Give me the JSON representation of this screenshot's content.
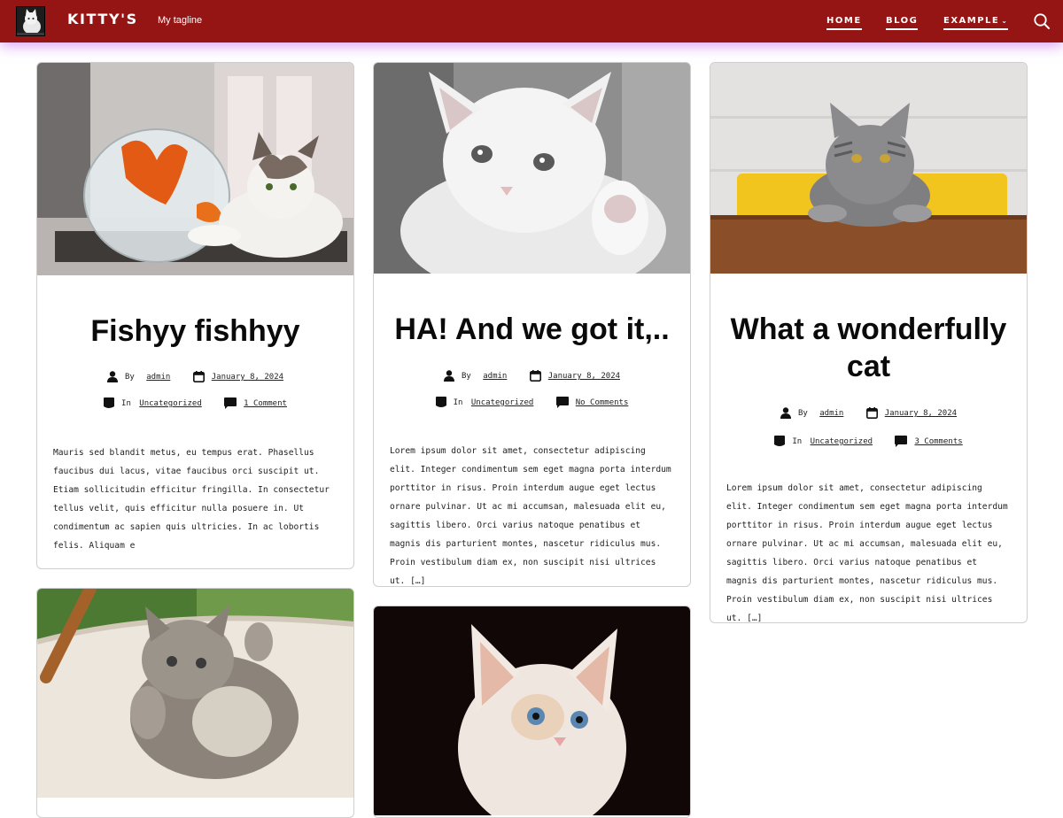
{
  "header": {
    "site_title": "KITTY'S",
    "tagline": "My tagline",
    "nav": [
      {
        "label": "HOME"
      },
      {
        "label": "BLOG"
      },
      {
        "label": "EXAMPLE"
      }
    ],
    "colors": {
      "bar": "#951515",
      "glow": "#be5aeb"
    }
  },
  "posts": [
    {
      "title": "Fishyy fishhyy",
      "by_label": "By",
      "author": "admin",
      "date": "January 8, 2024",
      "in_label": "In",
      "category": "Uncategorized",
      "comments": "1 Comment",
      "excerpt": "Mauris sed blandit metus, eu tempus erat. Phasellus faucibus dui lacus, vitae faucibus orci suscipit ut. Etiam sollicitudin efficitur fringilla. In consectetur tellus velit, quis efficitur nulla posuere in. Ut condimentum ac sapien quis ultricies. In ac lobortis felis. Aliquam e"
    },
    {
      "title": "HA! And we got it,..",
      "by_label": "By",
      "author": "admin",
      "date": "January 8, 2024",
      "in_label": "In",
      "category": "Uncategorized",
      "comments": "No Comments",
      "excerpt": "Lorem ipsum dolor sit amet, consectetur adipiscing elit. Integer condimentum sem eget magna porta interdum porttitor in risus. Proin interdum augue eget lectus ornare pulvinar. Ut ac mi accumsan, malesuada elit eu, sagittis libero. Orci varius natoque penatibus et magnis dis parturient montes, nascetur ridiculus mus. Proin vestibulum diam ex, non suscipit nisi ultrices ut. […]"
    },
    {
      "title": "What a wonderfully cat",
      "by_label": "By",
      "author": "admin",
      "date": "January 8, 2024",
      "in_label": "In",
      "category": "Uncategorized",
      "comments": "3 Comments",
      "excerpt": "Lorem ipsum dolor sit amet, consectetur adipiscing elit. Integer condimentum sem eget magna porta interdum porttitor in risus. Proin interdum augue eget lectus ornare pulvinar. Ut ac mi accumsan, malesuada elit eu, sagittis libero. Orci varius natoque penatibus et magnis dis parturient montes, nascetur ridiculus mus. Proin vestibulum diam ex, non suscipit nisi ultrices ut. […]"
    }
  ],
  "icons": {
    "author": "person-icon",
    "date": "calendar-icon",
    "category": "folder-icon",
    "comments": "comment-icon",
    "search": "search-icon"
  }
}
